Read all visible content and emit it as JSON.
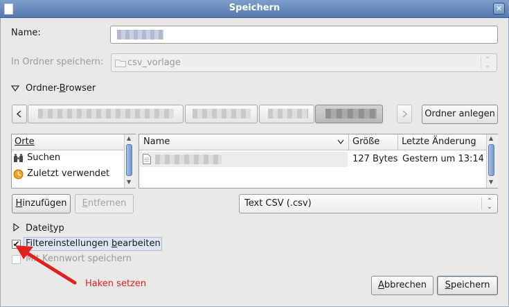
{
  "window": {
    "title": "Speichern",
    "close_glyph": "✕"
  },
  "name_label": "Name:",
  "folder_label": "In Ordner speichern:",
  "folder_value": "csv_vorlage",
  "browser_toggle": "Ordner-Browser",
  "create_folder_button": "Ordner anlegen",
  "places": {
    "header": "Orte",
    "items": [
      "Suchen",
      "Zuletzt verwendet"
    ]
  },
  "files": {
    "columns": [
      "Name",
      "Größe",
      "Letzte Änderung"
    ],
    "rows": [
      {
        "size": "127 Bytes",
        "modified": "Gestern um 13:14"
      }
    ]
  },
  "add_button": "Hinzufügen",
  "remove_button": "Entfernen",
  "filetype_value": "Text CSV (.csv)",
  "filetype_toggle": "Dateityp",
  "filter_checkbox": {
    "label": "Filtereinstellungen bearbeiten",
    "checked": true
  },
  "password_checkbox": {
    "label": "Mit Kennwort speichern",
    "checked": false
  },
  "annotation": {
    "text": "Haken setzen",
    "color": "#e02020"
  },
  "cancel_button": "Abbrechen",
  "save_button": "Speichern",
  "colors": {
    "titlebar": "#6a8cbe",
    "selection": "#cfdcef",
    "arrow": "#e02020"
  }
}
